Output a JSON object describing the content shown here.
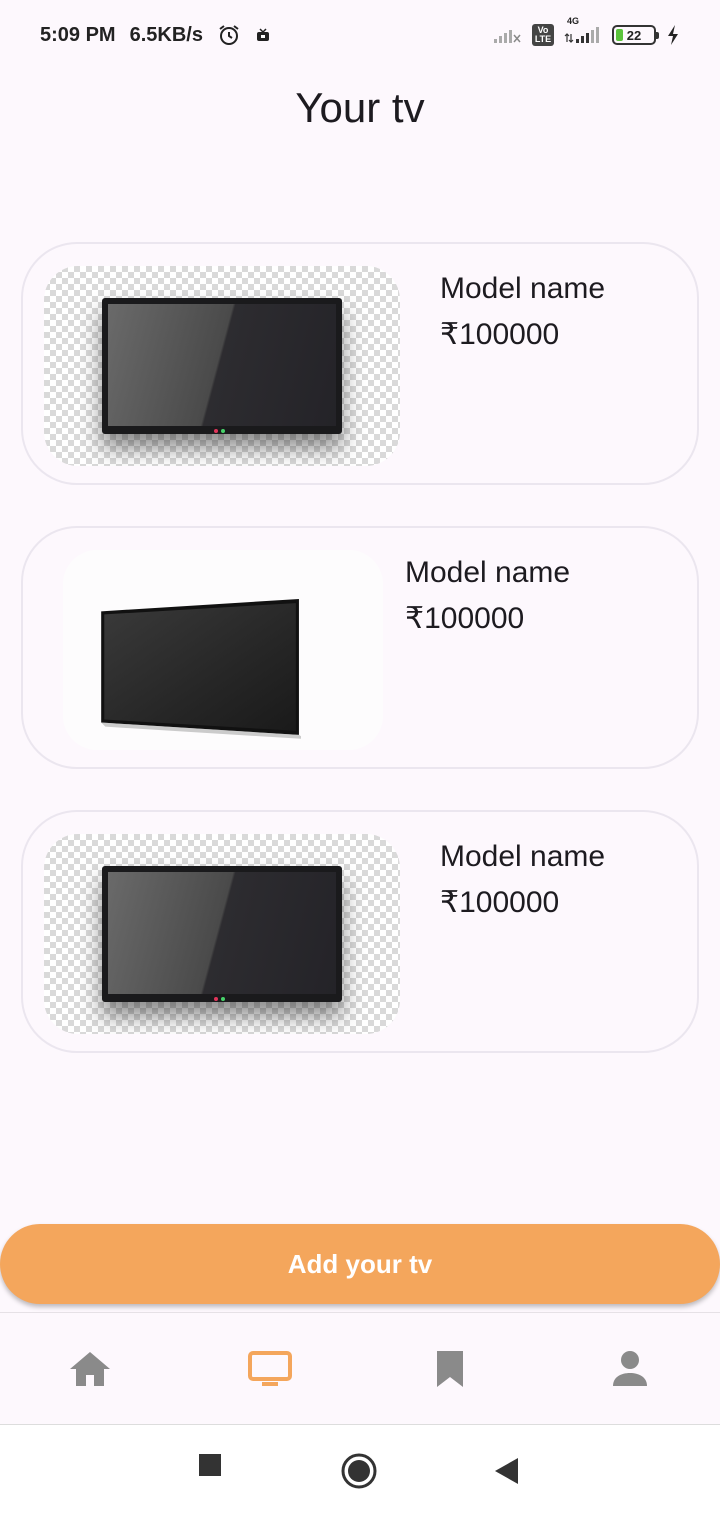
{
  "status_bar": {
    "time": "5:09 PM",
    "speed": "6.5KB/s",
    "network_label": "4G",
    "volte_label": "Vo\nLTE",
    "battery_level": "22",
    "icons": [
      "alarm-icon",
      "notification-icon",
      "signal-icon",
      "volte-icon",
      "signal-4g-icon",
      "battery-icon",
      "charging-icon"
    ]
  },
  "page": {
    "title": "Your tv"
  },
  "tv_list": [
    {
      "model": "Model name",
      "price": "₹100000",
      "image": "tv-flat-icon"
    },
    {
      "model": "Model name",
      "price": "₹100000",
      "image": "tv-angled-icon"
    },
    {
      "model": "Model name",
      "price": "₹100000",
      "image": "tv-flat-icon"
    }
  ],
  "actions": {
    "add_label": "Add your tv"
  },
  "bottom_nav": {
    "items": [
      {
        "name": "home",
        "icon": "home-icon",
        "active": false
      },
      {
        "name": "tv",
        "icon": "tv-icon",
        "active": true
      },
      {
        "name": "saved",
        "icon": "bookmark-icon",
        "active": false
      },
      {
        "name": "profile",
        "icon": "person-icon",
        "active": false
      }
    ]
  },
  "colors": {
    "accent": "#f4a65c",
    "nav_inactive": "#8a8a8a",
    "background": "#fdf8fd"
  }
}
